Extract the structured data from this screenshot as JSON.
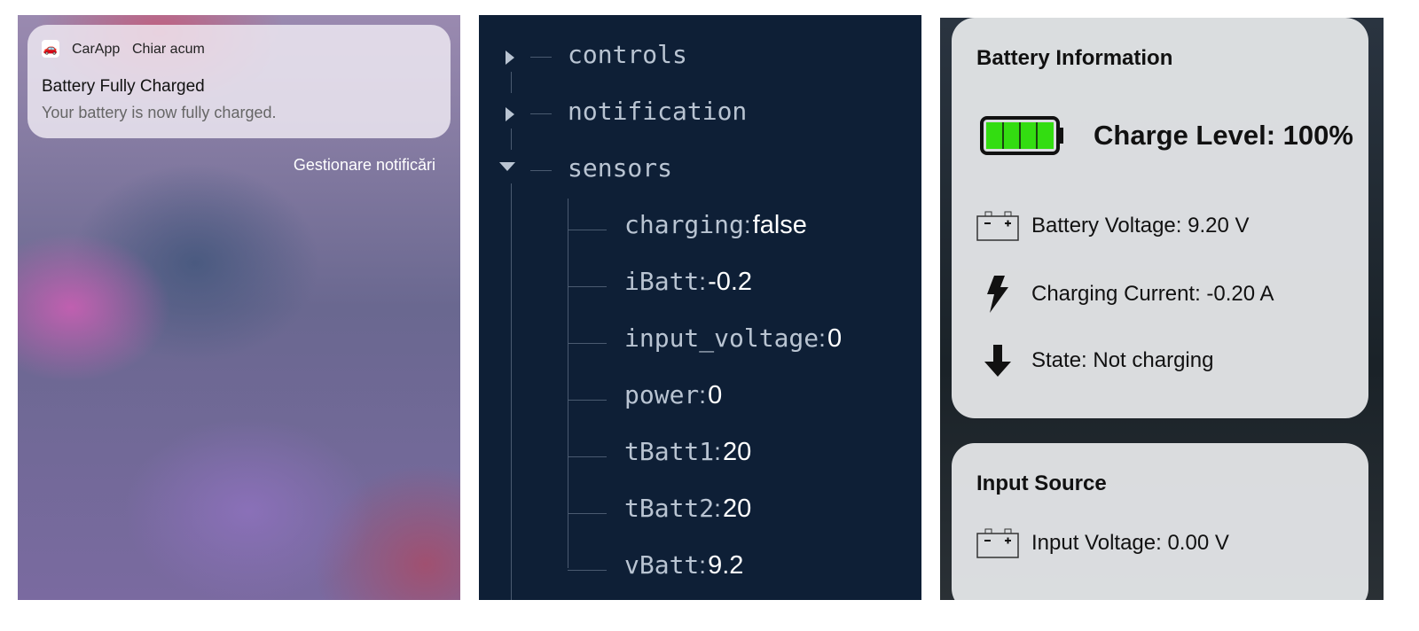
{
  "notification_panel": {
    "app_name": "CarApp",
    "time": "Chiar acum",
    "title": "Battery Fully Charged",
    "body": "Your battery is now fully charged.",
    "manage_label": "Gestionare notificări",
    "app_icon": "car-icon"
  },
  "tree": {
    "nodes": [
      {
        "key": "controls",
        "expanded": false
      },
      {
        "key": "notification",
        "expanded": false
      },
      {
        "key": "sensors",
        "expanded": true,
        "children": [
          {
            "key": "charging",
            "value": "false"
          },
          {
            "key": "iBatt",
            "value": "-0.2"
          },
          {
            "key": "input_voltage",
            "value": "0"
          },
          {
            "key": "power",
            "value": "0"
          },
          {
            "key": "tBatt1",
            "value": "20"
          },
          {
            "key": "tBatt2",
            "value": "20"
          },
          {
            "key": "vBatt",
            "value": "9.2"
          }
        ]
      }
    ]
  },
  "battery_card": {
    "title": "Battery Information",
    "charge_level": "Charge Level: 100%",
    "charge_percent": 100,
    "fill_color": "#33dd11",
    "rows": [
      {
        "icon": "car-battery-icon",
        "text": "Battery Voltage: 9.20 V"
      },
      {
        "icon": "lightning-icon",
        "text": "Charging Current: -0.20 A"
      },
      {
        "icon": "arrow-down-icon",
        "text": "State: Not charging"
      }
    ]
  },
  "input_card": {
    "title": "Input Source",
    "rows": [
      {
        "icon": "car-battery-icon",
        "text": "Input Voltage: 0.00 V"
      }
    ]
  }
}
